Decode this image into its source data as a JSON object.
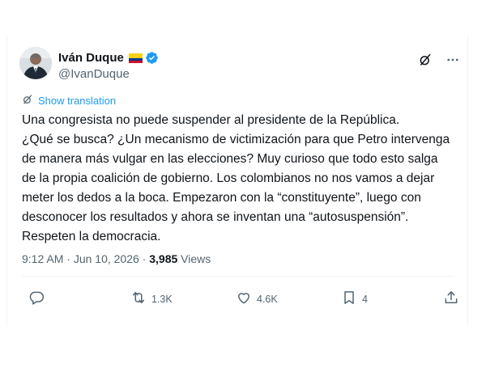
{
  "author": {
    "display_name": "Iván Duque",
    "handle": "@IvanDuque"
  },
  "icons": {
    "flag": "colombia-flag-icon",
    "verified": "verified-badge-icon",
    "grok": "grok-icon",
    "more": "more-icon",
    "translate": "translate-icon",
    "reply": "reply-icon",
    "retweet": "retweet-icon",
    "like": "like-icon",
    "bookmark": "bookmark-icon",
    "share": "share-icon"
  },
  "colors": {
    "text": "#0f1419",
    "secondary": "#536471",
    "accent": "#1d9bf0",
    "verified": "#1d9bf0",
    "flag_yellow": "#fcd116",
    "flag_blue": "#003893",
    "flag_red": "#ce1126"
  },
  "translate_label": "Show translation",
  "tweet_text": "Una congresista no puede suspender al presidente de la República.\n¿Qué se busca? ¿Un mecanismo de victimización para que Petro intervenga de manera más vulgar en las elecciones? Muy curioso que todo esto salga de la propia coalición de gobierno. Los colombianos no nos vamos a dejar meter los dedos a la boca. Empezaron con la “constituyente”, luego con desconocer los resultados y ahora se inventan una “autosuspensión”. Respeten la democracia.",
  "meta": {
    "time": "9:12 AM",
    "separator": " · ",
    "date": "Jun 10, 2026",
    "separator2": " · ",
    "views_count": "3,985",
    "views_label": " Views"
  },
  "actions": {
    "retweets": "1.3K",
    "likes": "4.6K",
    "bookmarks": "4"
  }
}
